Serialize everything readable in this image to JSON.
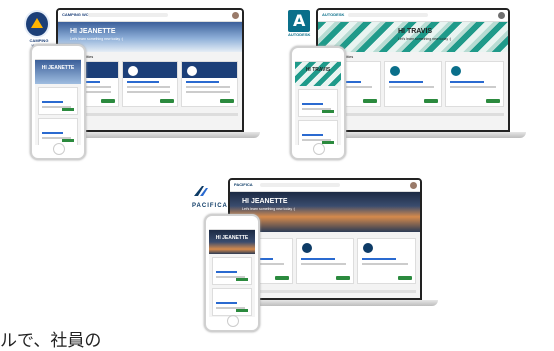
{
  "brands": {
    "camping_world": {
      "logo_text": "CAMPING WORLD",
      "header_text": "CAMPING WORLD",
      "color": "#1c3f78"
    },
    "autodesk": {
      "logo_text": "AUTODESK",
      "header_text": "AUTODESK",
      "color": "#0a6f8a"
    },
    "pacifica": {
      "logo_text": "PACIFICA",
      "header_text": "PACIFICA",
      "color": "#0d3b66"
    }
  },
  "screens": {
    "camping_world": {
      "greeting": "HI JEANETTE",
      "subtitle": "Let's learn something new today :)",
      "section": "Featured Activities",
      "phone_greeting": "HI JEANETTE",
      "phone_section": "Popular Guided Activities"
    },
    "autodesk": {
      "greeting": "HI TRAVIS",
      "subtitle": "Let's learn something new today :)",
      "section": "Featured Activities",
      "phone_greeting": "HI TRAVIS"
    },
    "pacifica": {
      "greeting": "HI JEANETTE",
      "subtitle": "Let's learn something new today :)",
      "phone_greeting": "HI JEANETTE"
    }
  },
  "caption": "ルで、社員の"
}
